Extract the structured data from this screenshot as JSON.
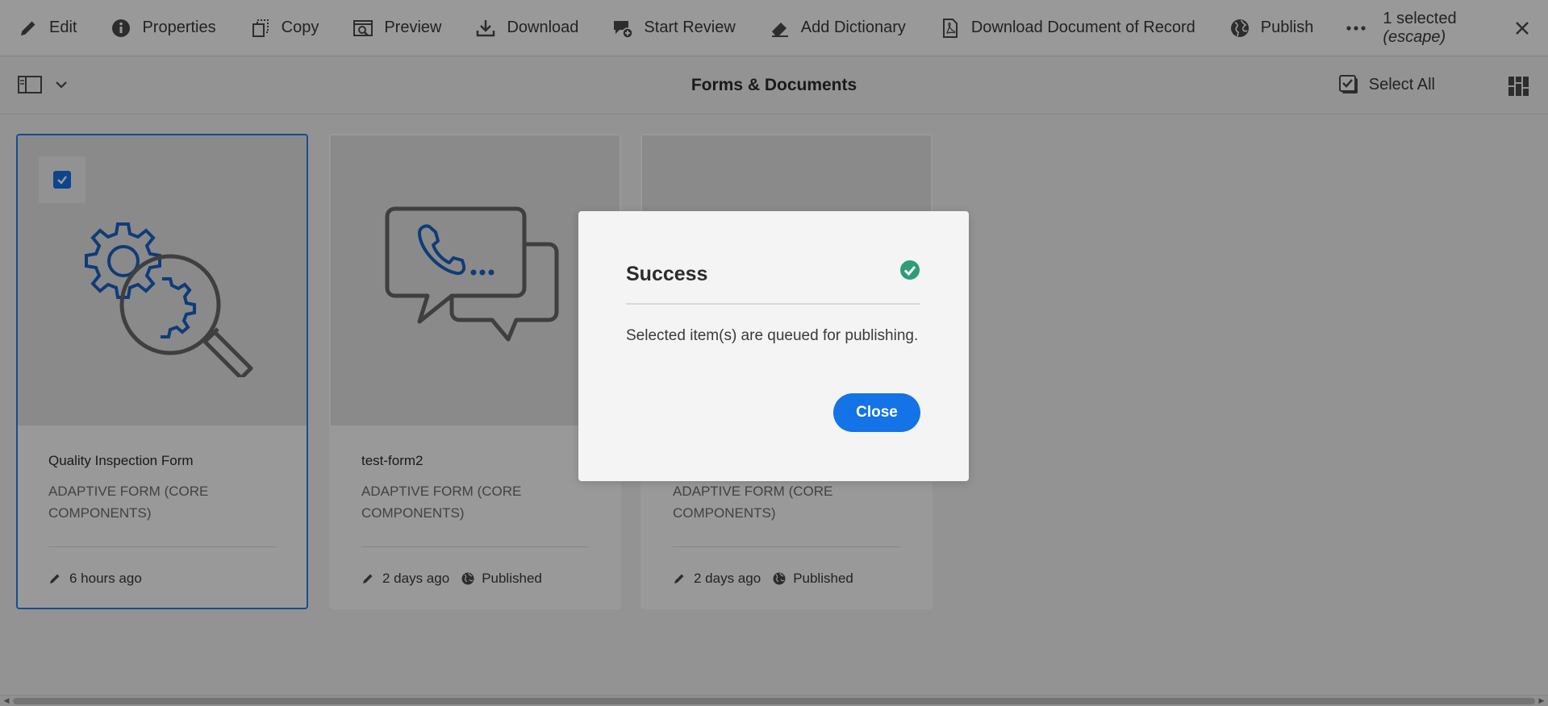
{
  "toolbar": {
    "actions": [
      {
        "label": "Edit",
        "icon": "pencil-icon"
      },
      {
        "label": "Properties",
        "icon": "info-icon"
      },
      {
        "label": "Copy",
        "icon": "copy-icon"
      },
      {
        "label": "Preview",
        "icon": "preview-icon"
      },
      {
        "label": "Download",
        "icon": "download-icon"
      },
      {
        "label": "Start Review",
        "icon": "chat-add-icon"
      },
      {
        "label": "Add Dictionary",
        "icon": "eraser-icon"
      },
      {
        "label": "Download Document of Record",
        "icon": "pdf-file-icon"
      },
      {
        "label": "Publish",
        "icon": "globe-icon"
      }
    ],
    "more_icon": "more-icon",
    "selection": {
      "count_text": "1 selected",
      "hint": "(escape)"
    },
    "close_icon": "close-icon"
  },
  "subbar": {
    "title": "Forms & Documents",
    "select_all_label": "Select All",
    "rail_icon": "rail-toggle-icon",
    "view_icon": "view-switcher-icon"
  },
  "cards": [
    {
      "title": "Quality Inspection Form",
      "type": "ADAPTIVE FORM (CORE COMPONENTS)",
      "modified": "6 hours ago",
      "status": "",
      "selected": true,
      "thumbnail_icon": "gear-magnifier-icon"
    },
    {
      "title": "test-form2",
      "type": "ADAPTIVE FORM (CORE COMPONENTS)",
      "modified": "2 days ago",
      "status": "Published",
      "selected": false,
      "thumbnail_icon": "phone-chat-icon"
    },
    {
      "title": "",
      "type": "ADAPTIVE FORM (CORE COMPONENTS)",
      "modified": "2 days ago",
      "status": "Published",
      "selected": false,
      "thumbnail_icon": ""
    }
  ],
  "dialog": {
    "title": "Success",
    "message": "Selected item(s) are queued for publishing.",
    "close_label": "Close",
    "status_icon": "success-check-icon"
  },
  "colors": {
    "accent": "#1473e6",
    "success": "#2d9d78",
    "selection_border": "#2680eb"
  }
}
